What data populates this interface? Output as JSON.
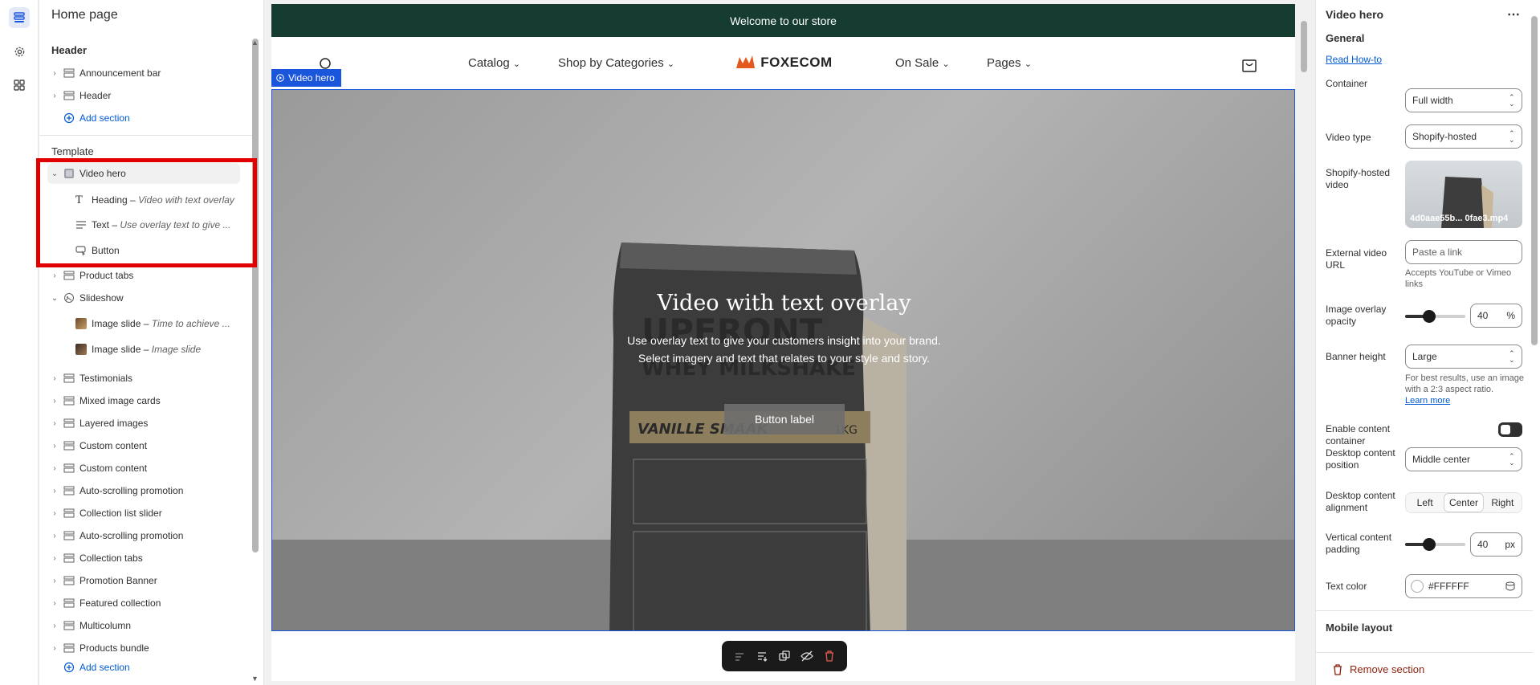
{
  "rail": {
    "icons": [
      "sections-icon",
      "settings-gear-icon",
      "apps-icon"
    ]
  },
  "tree": {
    "title": "Home page",
    "header_group": "Header",
    "header_items": [
      "Announcement bar",
      "Header"
    ],
    "add_section": "Add section",
    "template_group": "Template",
    "video_hero": "Video hero",
    "video_children": [
      {
        "label": "Heading",
        "detail": "Video with text overlay"
      },
      {
        "label": "Text",
        "detail": "Use overlay text to give ..."
      },
      {
        "label": "Button",
        "detail": ""
      }
    ],
    "product_tabs": "Product tabs",
    "slideshow": "Slideshow",
    "slideshow_children": [
      {
        "label": "Image slide",
        "detail": "Time to achieve ..."
      },
      {
        "label": "Image slide",
        "detail": "Image slide"
      }
    ],
    "sections": [
      "Testimonials",
      "Mixed image cards",
      "Layered images",
      "Custom content",
      "Custom content",
      "Auto-scrolling promotion",
      "Collection list slider",
      "Auto-scrolling promotion",
      "Collection tabs",
      "Promotion Banner",
      "Featured collection",
      "Multicolumn",
      "Products bundle"
    ],
    "add_section_bottom": "Add section",
    "dash": "–"
  },
  "preview": {
    "announcement": "Welcome to our store",
    "nav": {
      "catalog": "Catalog",
      "shop_by": "Shop by Categories",
      "logo": "FOXECOM",
      "on_sale": "On Sale",
      "pages": "Pages"
    },
    "section_tag": "Video hero",
    "heading": "Video with text overlay",
    "text_line1": "Use overlay text to give your customers insight into your brand.",
    "text_line2": "Select imagery and text that relates to your style and story.",
    "button": "Button label",
    "product_text": {
      "brand": "UPFRONT",
      "flavor": "WHEY MILKSHAKE",
      "label": "VANILLE SMAAK",
      "weight": "1KG"
    }
  },
  "settings": {
    "title": "Video hero",
    "general": "General",
    "read_howto": "Read How-to",
    "container_label": "Container",
    "container_value": "Full width",
    "video_type_label": "Video type",
    "video_type_value": "Shopify-hosted",
    "hosted_video_label": "Shopify-hosted video",
    "hosted_video_file": "4d0aae55b... 0fae3.mp4",
    "external_label": "External video URL",
    "external_placeholder": "Paste a link",
    "external_help": "Accepts YouTube or Vimeo links",
    "overlay_label": "Image overlay opacity",
    "overlay_value": "40",
    "overlay_unit": "%",
    "overlay_fraction": 0.4,
    "banner_label": "Banner height",
    "banner_value": "Large",
    "banner_help": "For best results, use an image with a 2:3 aspect ratio.",
    "banner_help_link": "Learn more",
    "container_toggle_label": "Enable content container",
    "position_label": "Desktop content position",
    "position_value": "Middle center",
    "alignment_label": "Desktop content alignment",
    "alignment_options": [
      "Left",
      "Center",
      "Right"
    ],
    "alignment_selected": "Center",
    "padding_label": "Vertical content padding",
    "padding_value": "40",
    "padding_unit": "px",
    "padding_fraction": 0.4,
    "text_color_label": "Text color",
    "text_color_value": "#FFFFFF",
    "mobile_layout": "Mobile layout",
    "remove_section": "Remove section"
  },
  "colors": {
    "accent": "#005bd3",
    "announcement_bg": "#163b30",
    "selection": "#1a56db",
    "highlight_box": "#e00000",
    "danger": "#8e1f0b"
  }
}
